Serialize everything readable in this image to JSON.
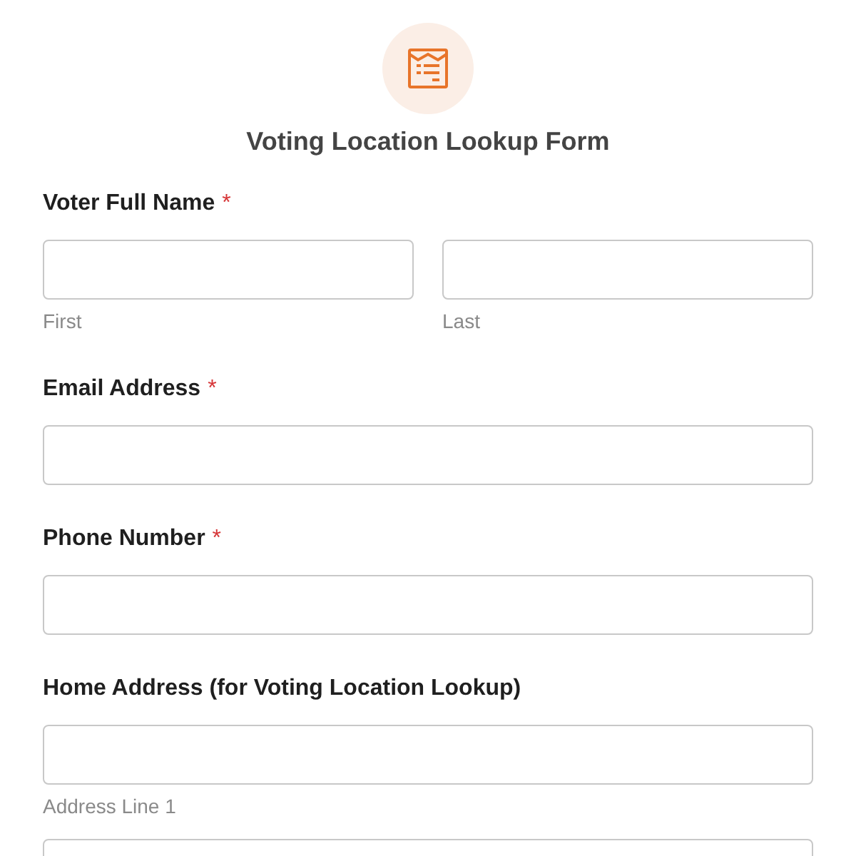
{
  "form": {
    "title": "Voting Location Lookup Form"
  },
  "fields": [
    {
      "kind": "split",
      "label": "Voter Full Name",
      "required_mark": "*",
      "inputs": [
        {
          "kind": "text",
          "sublabel": "First"
        },
        {
          "kind": "text",
          "sublabel": "Last"
        }
      ]
    },
    {
      "kind": "single",
      "label": "Email Address",
      "required_mark": "*",
      "inputs": [
        {
          "kind": "text"
        }
      ]
    },
    {
      "kind": "single",
      "label": "Phone Number",
      "required_mark": "*",
      "inputs": [
        {
          "kind": "text"
        }
      ]
    },
    {
      "kind": "stacked",
      "label": "Home Address (for Voting Location Lookup)",
      "inputs": [
        {
          "kind": "text",
          "sublabel": "Address Line 1"
        },
        {
          "kind": "text"
        }
      ]
    }
  ]
}
